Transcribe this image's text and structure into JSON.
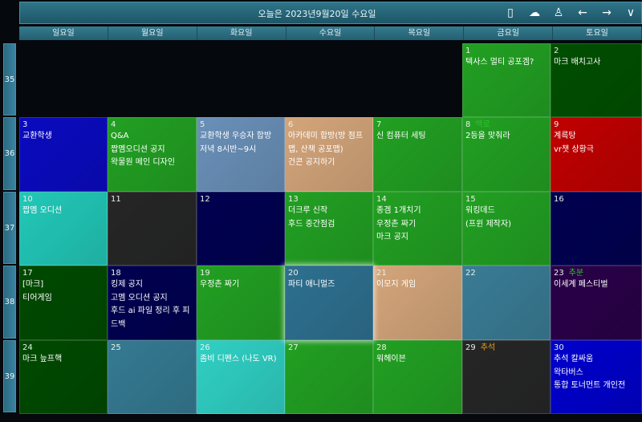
{
  "header": {
    "title": "오늘은 2023년9월20일 수요일",
    "icons": [
      "phone-icon",
      "cloud-help-icon",
      "user-icon",
      "arrow-left-icon",
      "arrow-right-icon",
      "chevron-down-icon"
    ]
  },
  "weekdays": [
    "일요일",
    "월요일",
    "화요일",
    "수요일",
    "목요일",
    "금요일",
    "토요일"
  ],
  "weeks": [
    "35",
    "36",
    "37",
    "38",
    "39"
  ],
  "days": [
    {
      "d": "1",
      "col": 5,
      "row": 0,
      "color": "#22a022",
      "events": [
        "텍사스 멀티 공포겜?"
      ]
    },
    {
      "d": "2",
      "col": 6,
      "row": 0,
      "color": "#004f00",
      "events": [
        "마크 배치고사"
      ]
    },
    {
      "d": "3",
      "col": 0,
      "row": 1,
      "color": "#0a0ac0",
      "events": [
        "교환학생"
      ]
    },
    {
      "d": "4",
      "col": 1,
      "row": 1,
      "color": "#22a022",
      "events": [
        "Q&A",
        "짭멤오디션 공지",
        "왁물원 메인 디자인"
      ]
    },
    {
      "d": "5",
      "col": 2,
      "row": 1,
      "color": "#6a90b8",
      "events": [
        "교환학생 우승자 합방",
        "저녁 8시반~9시"
      ]
    },
    {
      "d": "6",
      "col": 3,
      "row": 1,
      "color": "#d4a57a",
      "events": [
        "아카데미 합방(방 점프맵, 산책 공포맵)",
        "건콘 공지하기"
      ]
    },
    {
      "d": "7",
      "col": 4,
      "row": 1,
      "color": "#22a022",
      "events": [
        "신 컴퓨터 세팅"
      ]
    },
    {
      "d": "8",
      "col": 5,
      "row": 1,
      "color": "#22a022",
      "holiday": "백로",
      "holiday_color": "#30c030",
      "events": [
        "2등을 맞춰라"
      ]
    },
    {
      "d": "9",
      "col": 6,
      "row": 1,
      "color": "#c00000",
      "events": [
        "계륵탕",
        "vr챗 상황극"
      ]
    },
    {
      "d": "10",
      "col": 0,
      "row": 2,
      "color": "#22c8b8",
      "events": [
        "짭멤 오디션"
      ]
    },
    {
      "d": "11",
      "col": 1,
      "row": 2,
      "color": "#262626",
      "events": []
    },
    {
      "d": "12",
      "col": 2,
      "row": 2,
      "color": "#000050",
      "events": []
    },
    {
      "d": "13",
      "col": 3,
      "row": 2,
      "color": "#22a022",
      "events": [
        "더크루 신작",
        "후드 중간점검"
      ]
    },
    {
      "d": "14",
      "col": 4,
      "row": 2,
      "color": "#22a022",
      "events": [
        "종겜 1개치기",
        "우정촌 짜기",
        "마크 공지"
      ]
    },
    {
      "d": "15",
      "col": 5,
      "row": 2,
      "color": "#22a022",
      "events": [
        "워킹데드",
        "(프윈 제작자)"
      ]
    },
    {
      "d": "16",
      "col": 6,
      "row": 2,
      "color": "#000050",
      "events": []
    },
    {
      "d": "17",
      "col": 0,
      "row": 3,
      "color": "#004a00",
      "events": [
        "[마크]",
        "티어게임"
      ]
    },
    {
      "d": "18",
      "col": 1,
      "row": 3,
      "color": "#000050",
      "events": [
        "킹제 공지",
        "고멤 오디션 공지",
        "후드 ai 파일 정리 후 피드백"
      ]
    },
    {
      "d": "19",
      "col": 2,
      "row": 3,
      "color": "#22a022",
      "events": [
        "우정촌 짜기"
      ]
    },
    {
      "d": "20",
      "col": 3,
      "row": 3,
      "color": "#2e7090",
      "today": true,
      "events": [
        "파티 애니멀즈"
      ]
    },
    {
      "d": "21",
      "col": 4,
      "row": 3,
      "color": "#d4a57a",
      "events": [
        "이모지 게임"
      ]
    },
    {
      "d": "22",
      "col": 5,
      "row": 3,
      "color": "#3a7c95",
      "events": []
    },
    {
      "d": "23",
      "col": 6,
      "row": 3,
      "color": "#2a0048",
      "holiday": "추분",
      "holiday_color": "#30c030",
      "events": [
        "이세계 페스티벌"
      ]
    },
    {
      "d": "24",
      "col": 0,
      "row": 4,
      "color": "#004a00",
      "events": [
        "마크 늪프핵"
      ]
    },
    {
      "d": "25",
      "col": 1,
      "row": 4,
      "color": "#357a92",
      "events": []
    },
    {
      "d": "26",
      "col": 2,
      "row": 4,
      "color": "#30d0c4",
      "events": [
        "좀비 디펜스 (나도 VR)"
      ]
    },
    {
      "d": "27",
      "col": 3,
      "row": 4,
      "color": "#22a022",
      "events": []
    },
    {
      "d": "28",
      "col": 4,
      "row": 4,
      "color": "#22a022",
      "events": [
        "워헤이븐"
      ]
    },
    {
      "d": "29",
      "col": 5,
      "row": 4,
      "color": "#262626",
      "holiday": "추석",
      "holiday_color": "#e0a020",
      "events": []
    },
    {
      "d": "30",
      "col": 6,
      "row": 4,
      "color": "#0000cc",
      "events": [
        "추석 칼싸움",
        "왁타버스",
        "통합 토너먼트 개인전"
      ]
    }
  ]
}
